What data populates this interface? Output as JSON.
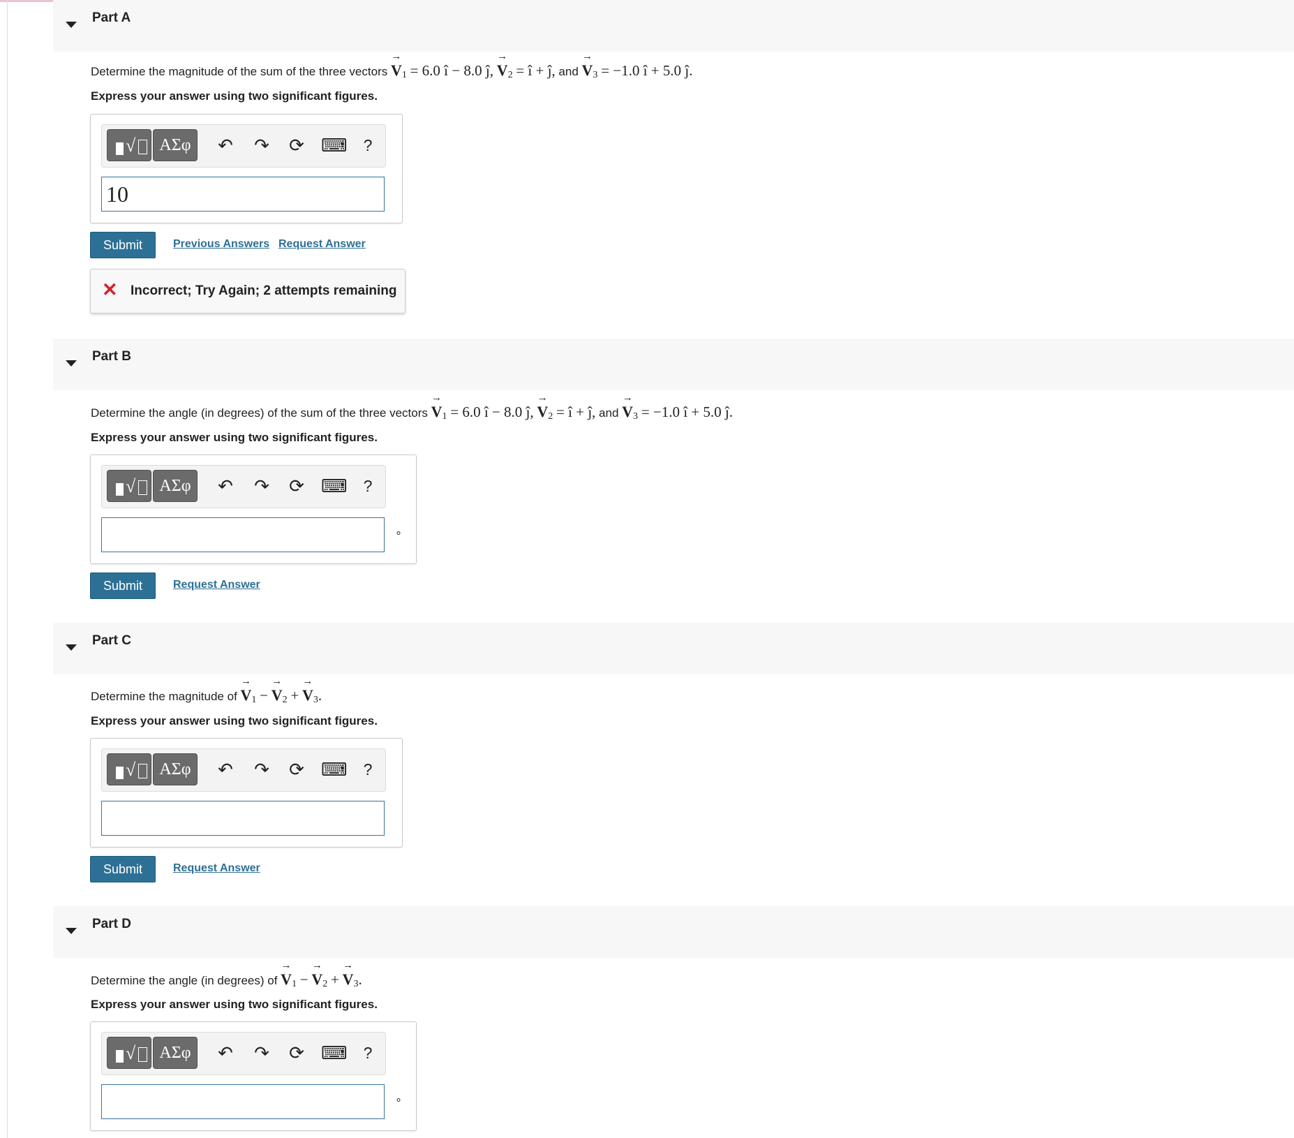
{
  "colors": {
    "accent": "#2d7095",
    "error": "#d4202a",
    "header_bg": "#f7f7f7"
  },
  "toolbar": {
    "greek_label": "ΑΣφ",
    "undo_icon": "undo-icon",
    "redo_icon": "redo-icon",
    "reset_icon": "reset-icon",
    "keyboard_icon": "keyboard-icon",
    "help_label": "?"
  },
  "math": {
    "v1": "V",
    "v1_sub": "1",
    "v2": "V",
    "v2_sub": "2",
    "v3": "V",
    "v3_sub": "3",
    "v1_expr": "= 6.0 î − 8.0 ĵ,",
    "v2_expr": "= î + ĵ,",
    "v3_expr": "= −1.0 î + 5.0 ĵ.",
    "minus": "−",
    "plus": "+",
    "end": "."
  },
  "parts": {
    "a": {
      "title": "Part A",
      "prompt_lead": "Determine the magnitude of the sum of the three vectors",
      "prompt_and": "and",
      "instruction": "Express your answer using two significant figures.",
      "answer_value": "10",
      "submit_label": "Submit",
      "previous_answers_label": "Previous Answers",
      "request_answer_label": "Request Answer",
      "feedback": "Incorrect; Try Again; 2 attempts remaining"
    },
    "b": {
      "title": "Part B",
      "prompt_lead": "Determine the angle (in degrees) of the sum of the three vectors",
      "prompt_and": "and",
      "instruction": "Express your answer using two significant figures.",
      "answer_value": "",
      "unit": "∘",
      "submit_label": "Submit",
      "request_answer_label": "Request Answer"
    },
    "c": {
      "title": "Part C",
      "prompt_lead": "Determine the magnitude of",
      "instruction": "Express your answer using two significant figures.",
      "answer_value": "",
      "submit_label": "Submit",
      "request_answer_label": "Request Answer"
    },
    "d": {
      "title": "Part D",
      "prompt_lead": "Determine the angle (in degrees) of",
      "instruction": "Express your answer using two significant figures.",
      "answer_value": "",
      "unit": "∘"
    }
  }
}
